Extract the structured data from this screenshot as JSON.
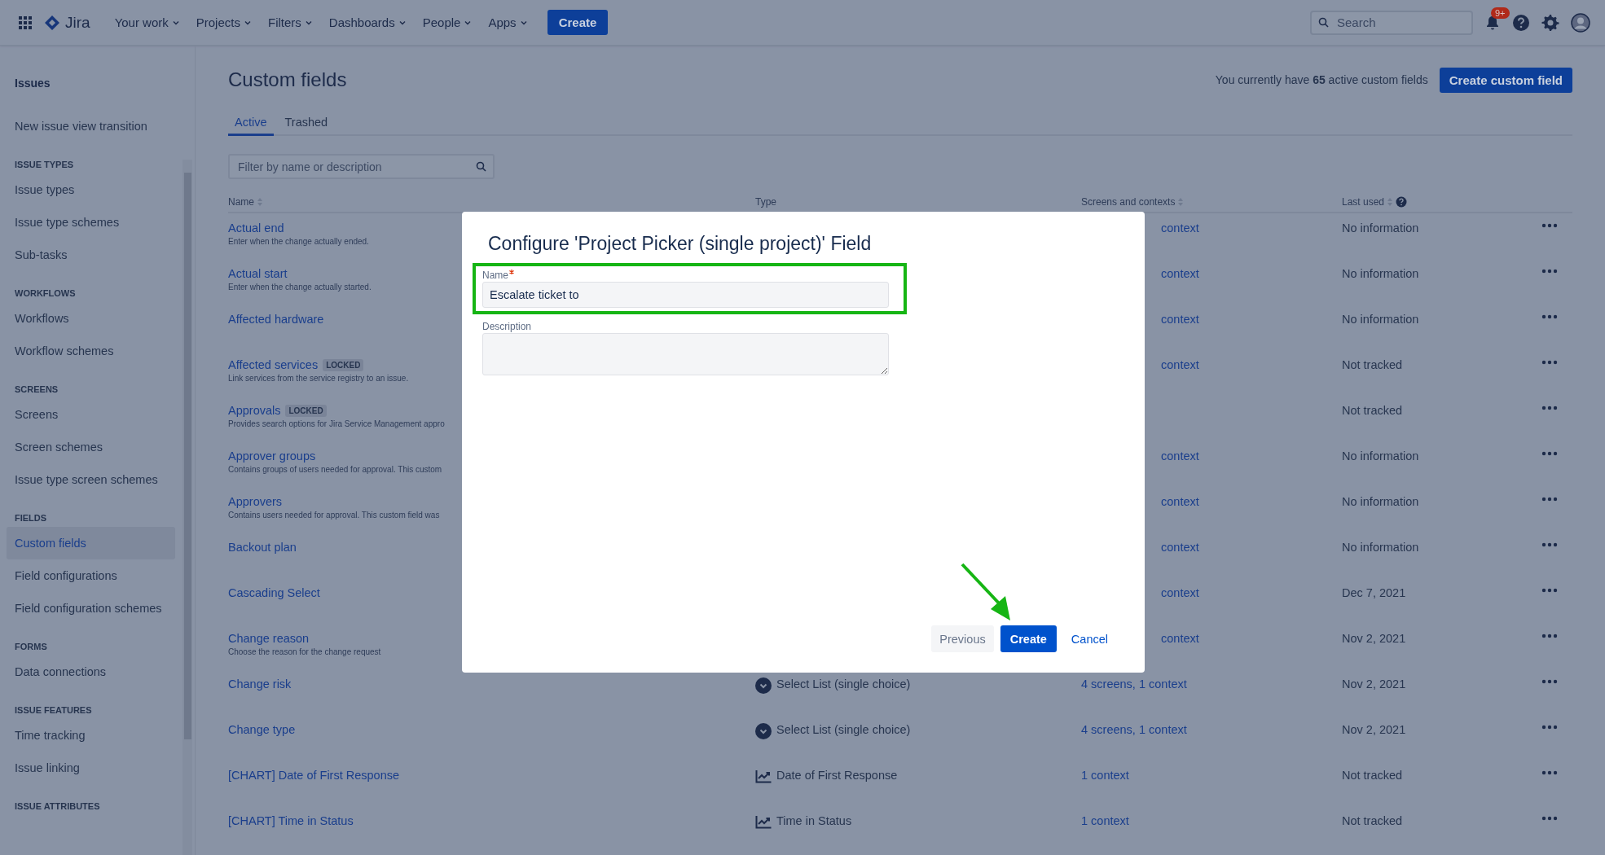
{
  "top_nav": {
    "product": "Jira",
    "items": [
      {
        "label": "Your work"
      },
      {
        "label": "Projects"
      },
      {
        "label": "Filters"
      },
      {
        "label": "Dashboards"
      },
      {
        "label": "People"
      },
      {
        "label": "Apps"
      }
    ],
    "create": "Create",
    "search": {
      "placeholder": "Search"
    },
    "notifications_badge": "9+"
  },
  "sidebar": {
    "title": "Issues",
    "sections": [
      {
        "items": [
          {
            "label": "New issue view transition",
            "selected": false
          }
        ]
      },
      {
        "heading": "ISSUE TYPES",
        "items": [
          {
            "label": "Issue types",
            "selected": false
          },
          {
            "label": "Issue type schemes",
            "selected": false
          },
          {
            "label": "Sub-tasks",
            "selected": false
          }
        ]
      },
      {
        "heading": "WORKFLOWS",
        "items": [
          {
            "label": "Workflows",
            "selected": false
          },
          {
            "label": "Workflow schemes",
            "selected": false
          }
        ]
      },
      {
        "heading": "SCREENS",
        "items": [
          {
            "label": "Screens",
            "selected": false
          },
          {
            "label": "Screen schemes",
            "selected": false
          },
          {
            "label": "Issue type screen schemes",
            "selected": false
          }
        ]
      },
      {
        "heading": "FIELDS",
        "items": [
          {
            "label": "Custom fields",
            "selected": true
          },
          {
            "label": "Field configurations",
            "selected": false
          },
          {
            "label": "Field configuration schemes",
            "selected": false
          }
        ]
      },
      {
        "heading": "FORMS",
        "items": [
          {
            "label": "Data connections",
            "selected": false
          }
        ]
      },
      {
        "heading": "ISSUE FEATURES",
        "items": [
          {
            "label": "Time tracking",
            "selected": false
          },
          {
            "label": "Issue linking",
            "selected": false
          }
        ]
      },
      {
        "heading": "ISSUE ATTRIBUTES"
      }
    ]
  },
  "page": {
    "title": "Custom fields",
    "summary": "You currently have **65** active custom fields",
    "create_button": "Create custom field",
    "tabs": [
      {
        "label": "Active",
        "selected": true
      },
      {
        "label": "Trashed",
        "selected": false
      }
    ],
    "filter": {
      "placeholder": "Filter by name or description"
    }
  },
  "table": {
    "columns": [
      {
        "label": "Name",
        "icons": [
          {
            "kind": "sort"
          }
        ]
      },
      {
        "label": "Type"
      },
      {
        "label": "Screens and contexts",
        "icons": [
          {
            "kind": "sort"
          }
        ]
      },
      {
        "label": "Last used",
        "icons": [
          {
            "kind": "sort"
          },
          {
            "kind": "help"
          }
        ]
      }
    ],
    "rows": [
      {
        "name": "Actual end",
        "description": "Enter when the change actually ended.",
        "screens": "context",
        "last_used": "No information"
      },
      {
        "name": "Actual start",
        "description": "Enter when the change actually started.",
        "screens": "context",
        "last_used": "No information"
      },
      {
        "name": "Affected hardware",
        "screens": "context",
        "last_used": "No information"
      },
      {
        "name": "Affected services",
        "badge": "LOCKED",
        "description": "Link services from the service registry to an issue.",
        "screens": "context",
        "last_used": "Not tracked"
      },
      {
        "name": "Approvals",
        "badge": "LOCKED",
        "description": "Provides search options for Jira Service Management appro",
        "last_used": "Not tracked"
      },
      {
        "name": "Approver groups",
        "description": "Contains groups of users needed for approval. This custom",
        "screens": "context",
        "last_used": "No information"
      },
      {
        "name": "Approvers",
        "description": "Contains users needed for approval. This custom field was",
        "screens": "context",
        "last_used": "No information"
      },
      {
        "name": "Backout plan",
        "screens": "context",
        "last_used": "No information"
      },
      {
        "name": "Cascading Select",
        "screens": "context",
        "last_used": "Dec 7, 2021"
      },
      {
        "name": "Change reason",
        "description": "Choose the reason for the change request",
        "screens": "context",
        "last_used": "Nov 2, 2021"
      },
      {
        "name": "Change risk",
        "type": {
          "kind": "select",
          "label": "Select List (single choice)"
        },
        "screens": "4 screens, 1 context",
        "last_used": "Nov 2, 2021"
      },
      {
        "name": "Change type",
        "type": {
          "kind": "select",
          "label": "Select List (single choice)"
        },
        "screens": "4 screens, 1 context",
        "last_used": "Nov 2, 2021"
      },
      {
        "name": "[CHART] Date of First Response",
        "type": {
          "kind": "chart",
          "label": "Date of First Response"
        },
        "screens": "1 context",
        "last_used": "Not tracked"
      },
      {
        "name": "[CHART] Time in Status",
        "type": {
          "kind": "chart",
          "label": "Time in Status"
        },
        "screens": "1 context",
        "last_used": "Not tracked"
      }
    ]
  },
  "dialog": {
    "title": "Configure 'Project Picker (single project)' Field",
    "fields": [
      {
        "kind": "input",
        "label": "Name",
        "required": true,
        "value": "Escalate ticket to",
        "highlighted": true
      },
      {
        "kind": "textarea",
        "label": "Description",
        "required": false,
        "highlighted": false
      }
    ],
    "buttons": [
      {
        "kind": "subtle",
        "label": "Previous",
        "pointed": false
      },
      {
        "kind": "primary",
        "label": "Create",
        "pointed": true
      },
      {
        "kind": "link",
        "label": "Cancel",
        "pointed": false
      }
    ]
  }
}
